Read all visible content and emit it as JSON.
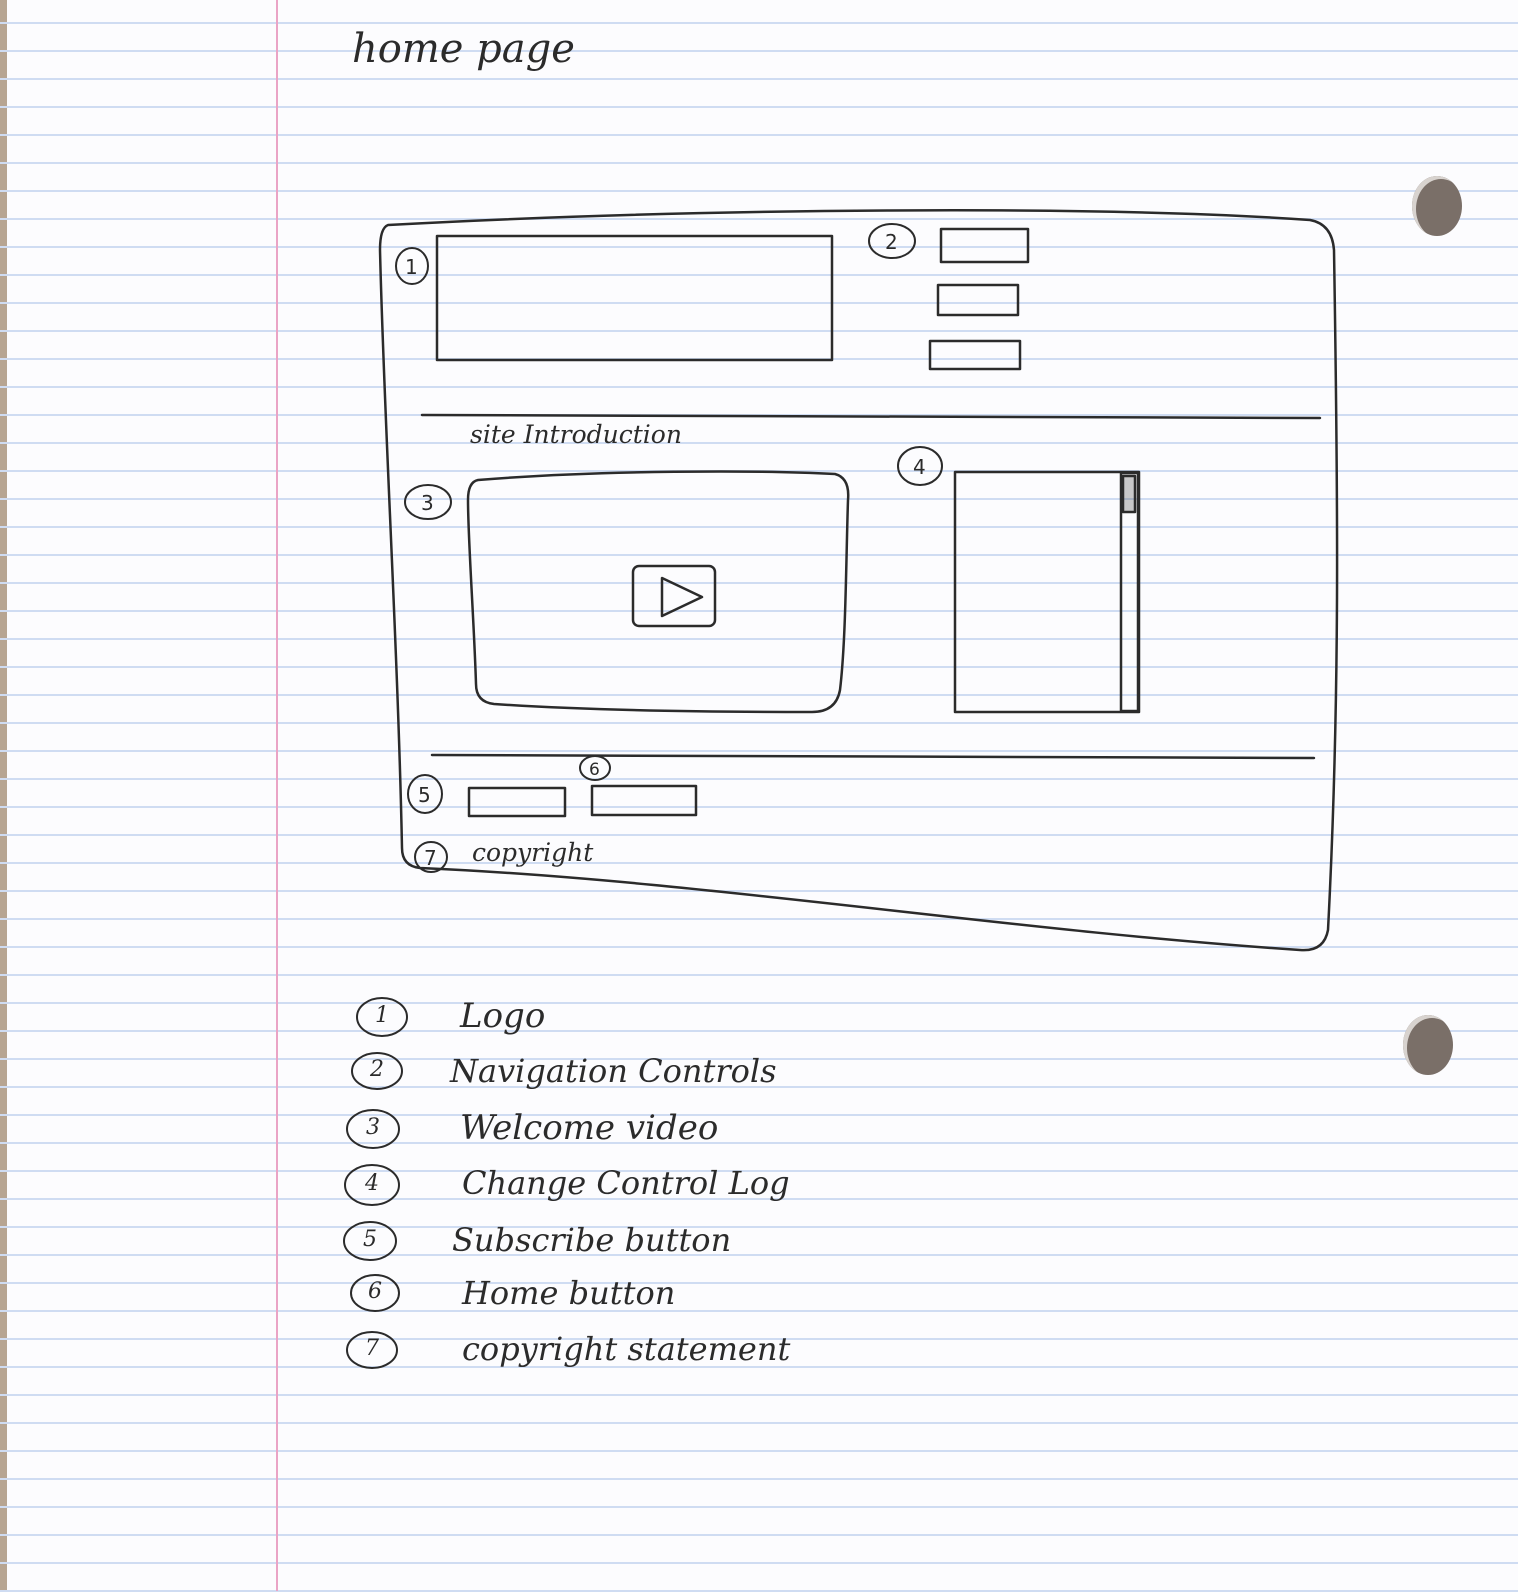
{
  "page_title": "home page",
  "wireframe": {
    "section_label": "site Introduction",
    "footer_copyright_label": "copyright",
    "markers": {
      "logo": "1",
      "nav": "2",
      "video": "3",
      "log": "4",
      "subscribe": "5",
      "home": "6",
      "copyright": "7"
    }
  },
  "legend": [
    {
      "num": "1",
      "label": "Logo"
    },
    {
      "num": "2",
      "label": "Navigation Controls"
    },
    {
      "num": "3",
      "label": "Welcome video"
    },
    {
      "num": "4",
      "label": "Change Control Log"
    },
    {
      "num": "5",
      "label": "Subscribe button"
    },
    {
      "num": "6",
      "label": "Home button"
    },
    {
      "num": "7",
      "label": "copyright statement"
    }
  ],
  "colors": {
    "ink": "#2b2b2b",
    "rule_line": "#cfdcf2",
    "margin_line": "#eaa4c6",
    "paper": "#fcfcfe"
  },
  "icons": {
    "play": "play-icon",
    "binder_hole": "binder-hole"
  }
}
